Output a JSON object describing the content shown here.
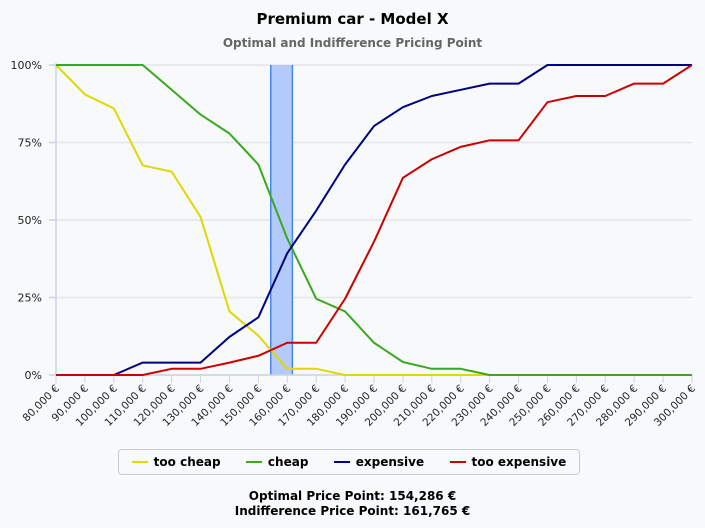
{
  "chart_data": {
    "type": "line",
    "title": "Premium car - Model X",
    "subtitle": "Optimal and Indifference Pricing Point",
    "xlabel": "",
    "ylabel": "",
    "x": [
      80000,
      90000,
      100000,
      110000,
      120000,
      130000,
      140000,
      150000,
      160000,
      170000,
      180000,
      190000,
      200000,
      210000,
      220000,
      230000,
      240000,
      250000,
      260000,
      270000,
      280000,
      290000,
      300000
    ],
    "x_tick_labels": [
      "80,000 €",
      "90,000 €",
      "100,000 €",
      "110,000 €",
      "120,000 €",
      "130,000 €",
      "140,000 €",
      "150,000 €",
      "160,000 €",
      "170,000 €",
      "180,000 €",
      "190,000 €",
      "200,000 €",
      "210,000 €",
      "220,000 €",
      "230,000 €",
      "240,000 €",
      "250,000 €",
      "260,000 €",
      "270,000 €",
      "280,000 €",
      "290,000 €",
      "300,000 €"
    ],
    "y_ticks": [
      0,
      25,
      50,
      75,
      100
    ],
    "y_tick_labels": [
      "0%",
      "25%",
      "50%",
      "75%",
      "100%"
    ],
    "ylim": [
      0,
      100
    ],
    "xlim": [
      80000,
      300000
    ],
    "grid": true,
    "legend_position": "bottom",
    "series": [
      {
        "name": "too cheap",
        "color": "#e0d800",
        "values": [
          100,
          90.5,
          86,
          67.6,
          65.6,
          51,
          20.5,
          12.7,
          2,
          2,
          0,
          0,
          0,
          0,
          0,
          0,
          0,
          0,
          0,
          0,
          0,
          0,
          0
        ]
      },
      {
        "name": "cheap",
        "color": "#3aa820",
        "values": [
          100,
          100,
          100,
          100,
          92,
          84,
          77.9,
          67.9,
          44,
          24.6,
          20.5,
          10.4,
          4.2,
          2,
          2,
          0,
          0,
          0,
          0,
          0,
          0,
          0,
          0
        ]
      },
      {
        "name": "expensive",
        "color": "#000080",
        "values": [
          0,
          0,
          0,
          4,
          4,
          4,
          12.3,
          18.6,
          39.3,
          53,
          67.9,
          80.3,
          86.4,
          90,
          92,
          94,
          94,
          100,
          100,
          100,
          100,
          100,
          100
        ]
      },
      {
        "name": "too expensive",
        "color": "#cc0000",
        "values": [
          0,
          0,
          0,
          0,
          2,
          2,
          4,
          6.2,
          10.4,
          10.4,
          24.6,
          43,
          63.6,
          69.6,
          73.6,
          75.7,
          75.7,
          88,
          90,
          90,
          94,
          94,
          100
        ]
      }
    ],
    "band": {
      "from": 154286,
      "to": 161765,
      "fill": "#b3cbfb",
      "edge": "#4a86f0"
    },
    "annotations": [
      "Optimal Price Point: 154,286 €",
      "Indifference Price Point: 161,765 €"
    ]
  }
}
